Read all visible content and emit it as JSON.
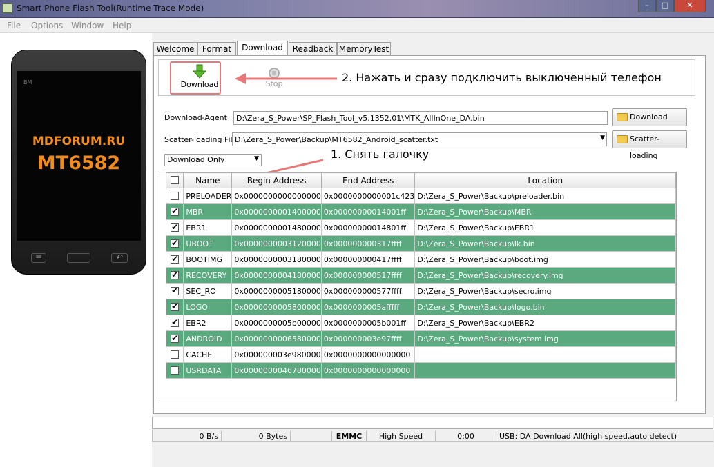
{
  "window": {
    "title": "Smart Phone Flash Tool(Runtime Trace Mode)"
  },
  "menu": [
    "File",
    "Options",
    "Window",
    "Help"
  ],
  "phone": {
    "brand_small": "BM",
    "line1": "MDFORUM.RU",
    "line2": "MT6582"
  },
  "tabs": [
    "Welcome",
    "Format",
    "Download",
    "Readback",
    "MemoryTest"
  ],
  "toolbar": {
    "download_label": "Download",
    "stop_label": "Stop"
  },
  "annotations": {
    "step2": "2. Нажать и сразу подключить выключенный телефон",
    "step1": "1. Снять галочку"
  },
  "download_agent": {
    "label": "Download-Agent",
    "value": "D:\\Zera_S_Power\\SP_Flash_Tool_v5.1352.01\\MTK_AllInOne_DA.bin",
    "button": "Download Agent"
  },
  "scatter": {
    "label": "Scatter-loading File",
    "value": "D:\\Zera_S_Power\\Backup\\MT6582_Android_scatter.txt",
    "button": "Scatter-loading"
  },
  "mode_select": "Download Only",
  "table": {
    "headers": [
      "",
      "Name",
      "Begin Address",
      "End Address",
      "Location"
    ],
    "rows": [
      {
        "checked": false,
        "name": "PRELOADER",
        "begin": "0x0000000000000000",
        "end": "0x0000000000001c423",
        "location": "D:\\Zera_S_Power\\Backup\\preloader.bin",
        "style": "w"
      },
      {
        "checked": true,
        "name": "MBR",
        "begin": "0x0000000001400000",
        "end": "0x00000000014001ff",
        "location": "D:\\Zera_S_Power\\Backup\\MBR",
        "style": "g"
      },
      {
        "checked": true,
        "name": "EBR1",
        "begin": "0x0000000001480000",
        "end": "0x00000000014801ff",
        "location": "D:\\Zera_S_Power\\Backup\\EBR1",
        "style": "w"
      },
      {
        "checked": true,
        "name": "UBOOT",
        "begin": "0x0000000003120000",
        "end": "0x000000000317ffff",
        "location": "D:\\Zera_S_Power\\Backup\\lk.bin",
        "style": "g"
      },
      {
        "checked": true,
        "name": "BOOTIMG",
        "begin": "0x0000000003180000",
        "end": "0x000000000417ffff",
        "location": "D:\\Zera_S_Power\\Backup\\boot.img",
        "style": "w"
      },
      {
        "checked": true,
        "name": "RECOVERY",
        "begin": "0x0000000004180000",
        "end": "0x000000000517ffff",
        "location": "D:\\Zera_S_Power\\Backup\\recovery.img",
        "style": "g"
      },
      {
        "checked": true,
        "name": "SEC_RO",
        "begin": "0x0000000005180000",
        "end": "0x000000000577ffff",
        "location": "D:\\Zera_S_Power\\Backup\\secro.img",
        "style": "w"
      },
      {
        "checked": true,
        "name": "LOGO",
        "begin": "0x0000000005800000",
        "end": "0x0000000005afffff",
        "location": "D:\\Zera_S_Power\\Backup\\logo.bin",
        "style": "g"
      },
      {
        "checked": true,
        "name": "EBR2",
        "begin": "0x0000000005b00000",
        "end": "0x0000000005b001ff",
        "location": "D:\\Zera_S_Power\\Backup\\EBR2",
        "style": "w"
      },
      {
        "checked": true,
        "name": "ANDROID",
        "begin": "0x0000000006580000",
        "end": "0x000000003e97ffff",
        "location": "D:\\Zera_S_Power\\Backup\\system.img",
        "style": "g"
      },
      {
        "checked": false,
        "name": "CACHE",
        "begin": "0x000000003e980000",
        "end": "0x0000000000000000",
        "location": "",
        "style": "w"
      },
      {
        "checked": false,
        "name": "USRDATA",
        "begin": "0x0000000046780000",
        "end": "0x0000000000000000",
        "location": "",
        "style": "g"
      }
    ]
  },
  "status": {
    "speed": "0 B/s",
    "bytes": "0 Bytes",
    "storage": "EMMC",
    "mode": "High Speed",
    "time": "0:00",
    "usb": "USB: DA Download All(high speed,auto detect)"
  },
  "colors": {
    "row_green": "#5aa97f",
    "annotation_red": "#e87878",
    "phone_text": "#f08c1e"
  }
}
